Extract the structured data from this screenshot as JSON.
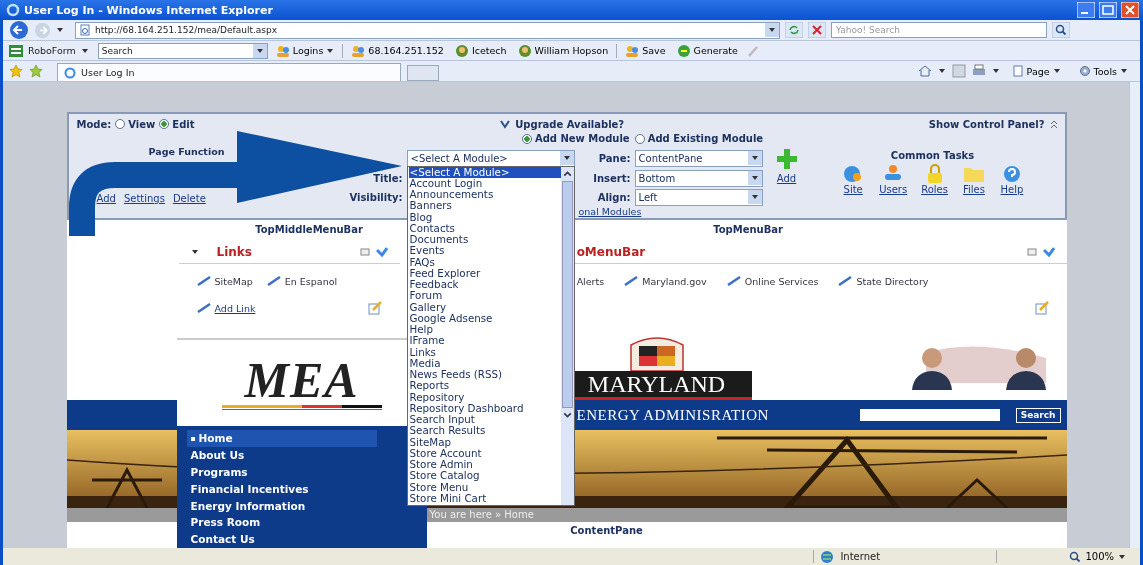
{
  "window": {
    "title": "User Log In - Windows Internet Explorer"
  },
  "address_bar": {
    "url": "http://68.164.251.152/mea/Default.aspx"
  },
  "search_box": {
    "placeholder": "Yahoo! Search"
  },
  "roboform": {
    "brand": "RoboForm",
    "search_value": "Search",
    "buttons": [
      {
        "label": "Logins",
        "kind": "menu"
      },
      {
        "label": "68.164.251.152",
        "kind": "site"
      },
      {
        "label": "Icetech",
        "kind": "person"
      },
      {
        "label": "William Hopson",
        "kind": "person"
      },
      {
        "label": "Save",
        "kind": "save"
      },
      {
        "label": "Generate",
        "kind": "generate"
      }
    ]
  },
  "tabs": [
    {
      "label": "User Log In",
      "selected": true
    }
  ],
  "command_bar": [
    "Page",
    "Tools"
  ],
  "control_panel": {
    "mode_label": "Mode:",
    "modes": [
      {
        "label": "View",
        "selected": false
      },
      {
        "label": "Edit",
        "selected": true
      }
    ],
    "upgrade": "Upgrade Available?",
    "show_panel": "Show Control Panel?",
    "module_options": [
      {
        "label": "Add New Module",
        "selected": true
      },
      {
        "label": "Add Existing Module",
        "selected": false
      }
    ],
    "page_functions_title": "Page Function",
    "page_actions": [
      "Add",
      "Settings",
      "Delete"
    ],
    "title_label": "Title:",
    "visibility_label": "Visibility:",
    "fields": [
      {
        "label": "Pane:",
        "value": "ContentPane"
      },
      {
        "label": "Insert:",
        "value": "Bottom"
      },
      {
        "label": "Align:",
        "value": "Left"
      }
    ],
    "add_button": "Add",
    "modules_link": "onal Modules",
    "common_tasks_title": "Common Tasks",
    "common_tasks": [
      {
        "label": "Site",
        "kind": "site"
      },
      {
        "label": "Users",
        "kind": "users"
      },
      {
        "label": "Roles",
        "kind": "roles"
      },
      {
        "label": "Files",
        "kind": "files"
      },
      {
        "label": "Help",
        "kind": "help"
      }
    ]
  },
  "module_select": {
    "value": "<Select A Module>",
    "options": [
      {
        "label": "<Select A Module>",
        "selected": true
      },
      {
        "label": "Account Login",
        "selected": false
      },
      {
        "label": "Announcements",
        "selected": false
      },
      {
        "label": "Banners",
        "selected": false
      },
      {
        "label": "Blog",
        "selected": false
      },
      {
        "label": "Contacts",
        "selected": false
      },
      {
        "label": "Documents",
        "selected": false
      },
      {
        "label": "Events",
        "selected": false
      },
      {
        "label": "FAQs",
        "selected": false
      },
      {
        "label": "Feed Explorer",
        "selected": false
      },
      {
        "label": "Feedback",
        "selected": false
      },
      {
        "label": "Forum",
        "selected": false
      },
      {
        "label": "Gallery",
        "selected": false
      },
      {
        "label": "Google Adsense",
        "selected": false
      },
      {
        "label": "Help",
        "selected": false
      },
      {
        "label": "IFrame",
        "selected": false
      },
      {
        "label": "Links",
        "selected": false
      },
      {
        "label": "Media",
        "selected": false
      },
      {
        "label": "News Feeds (RSS)",
        "selected": false
      },
      {
        "label": "Reports",
        "selected": false
      },
      {
        "label": "Repository",
        "selected": false
      },
      {
        "label": "Repository Dashboard",
        "selected": false
      },
      {
        "label": "Search Input",
        "selected": false
      },
      {
        "label": "Search Results",
        "selected": false
      },
      {
        "label": "SiteMap",
        "selected": false
      },
      {
        "label": "Store Account",
        "selected": false
      },
      {
        "label": "Store Admin",
        "selected": false
      },
      {
        "label": "Store Catalog",
        "selected": false
      },
      {
        "label": "Store Menu",
        "selected": false
      },
      {
        "label": "Store Mini Cart",
        "selected": false
      }
    ]
  },
  "panes": {
    "left": "TopMiddleMenuBar",
    "right": "TopMenuBar",
    "content": "ContentPane"
  },
  "links_module": {
    "title": "Links",
    "links": [
      "SiteMap",
      "En Espanol"
    ],
    "add_link": "Add Link"
  },
  "menu_module": {
    "title": "oMenuBar",
    "links": [
      "Alerts",
      "Maryland.gov",
      "Online Services",
      "State Directory"
    ]
  },
  "header": {
    "logo": "MEA",
    "state": "MARYLAND",
    "agency": "ENERGY ADMINISRATION",
    "search_button": "Search"
  },
  "nav": [
    {
      "label": "Home",
      "selected": true
    },
    {
      "label": "About Us",
      "selected": false
    },
    {
      "label": "Programs",
      "selected": false
    },
    {
      "label": "Financial Incentives",
      "selected": false
    },
    {
      "label": "Energy Information",
      "selected": false
    },
    {
      "label": "Press Room",
      "selected": false
    },
    {
      "label": "Contact Us",
      "selected": false
    }
  ],
  "breadcrumb": "You are here » Home",
  "status_bar": {
    "zone": "Internet",
    "zoom": "100%"
  }
}
